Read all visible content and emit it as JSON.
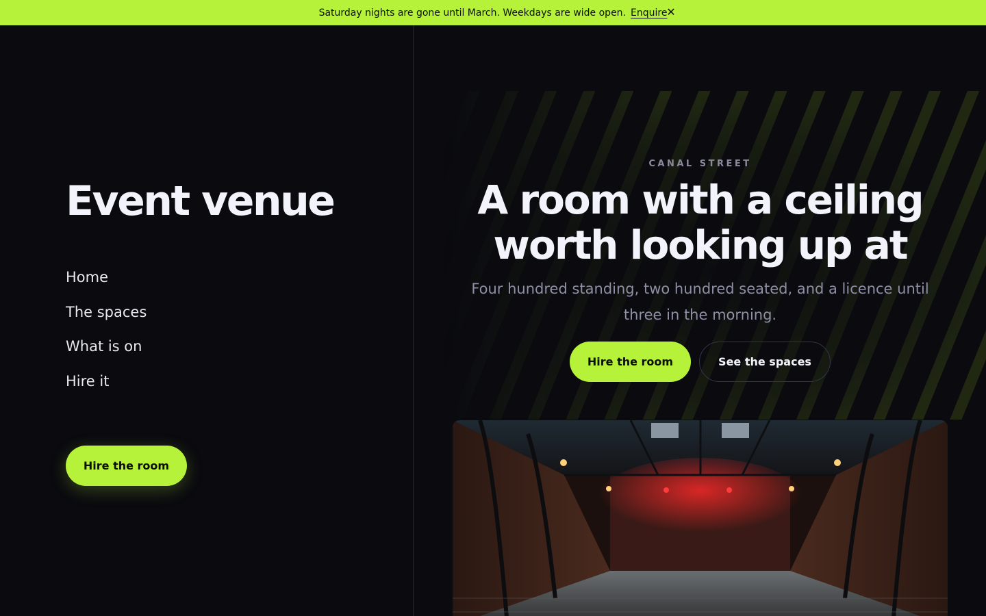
{
  "banner": {
    "message": "Saturday nights are gone until March. Weekdays are wide open.",
    "link_label": "Enquire",
    "close_glyph": "✕"
  },
  "sidebar": {
    "brand": "Event venue",
    "nav": [
      {
        "label": "Home"
      },
      {
        "label": "The spaces"
      },
      {
        "label": "What is on"
      },
      {
        "label": "Hire it"
      }
    ],
    "cta_label": "Hire the room"
  },
  "hero": {
    "eyebrow": "CANAL STREET",
    "headline": "A room with a ceiling worth looking up at",
    "subheading": "Four hundred standing, two hundred seated, and a licence until three in the morning.",
    "primary_cta": "Hire the room",
    "secondary_cta": "See the spaces"
  },
  "colors": {
    "accent": "#b6f23a",
    "background": "#0a0a0f",
    "text": "#f3f3fb",
    "muted": "#8f8fa6"
  },
  "icons": {
    "close": "close-icon",
    "photo": "venue-hall-photo"
  }
}
